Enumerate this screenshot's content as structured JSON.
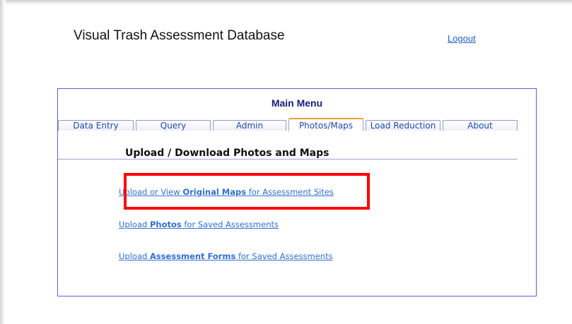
{
  "header": {
    "app_title": "Visual Trash Assessment Database",
    "logout_label": "Logout"
  },
  "panel": {
    "title": "Main Menu",
    "tabs": [
      {
        "label": "Data Entry",
        "active": false
      },
      {
        "label": "Query",
        "active": false
      },
      {
        "label": "Admin",
        "active": false
      },
      {
        "label": "Photos/Maps",
        "active": true
      },
      {
        "label": "Load Reduction",
        "active": false
      },
      {
        "label": "About",
        "active": false
      }
    ],
    "section_heading": "Upload / Download Photos and Maps",
    "links": [
      {
        "prefix": "Upload or View ",
        "bold": "Original Maps",
        "suffix": " for Assessment Sites",
        "highlighted": true
      },
      {
        "prefix": "Upload ",
        "bold": "Photos",
        "suffix": " for Saved Assessments",
        "highlighted": false
      },
      {
        "prefix": "Upload ",
        "bold": "Assessment Forms",
        "suffix": " for Saved Assessments",
        "highlighted": false
      }
    ]
  },
  "colors": {
    "panel_border": "#5b62c8",
    "link": "#2f6fd0",
    "active_tab_accent": "#f0a030",
    "highlight": "#ff0000"
  }
}
